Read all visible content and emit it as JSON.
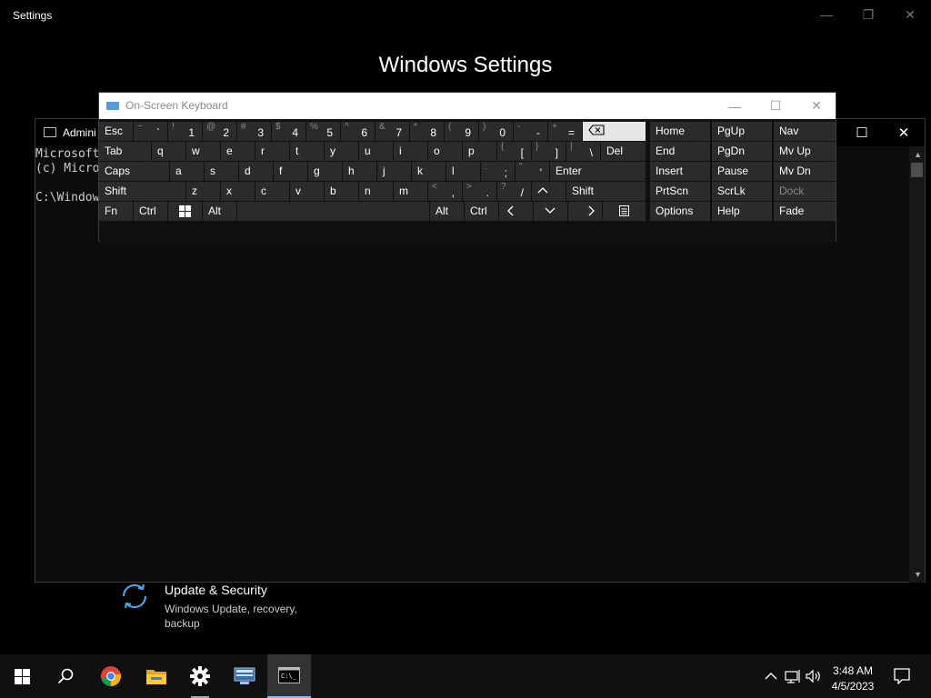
{
  "settings": {
    "title": "Settings",
    "heading": "Windows Settings",
    "tile": {
      "title": "Update & Security",
      "desc_line1": "Windows Update, recovery,",
      "desc_line2": "backup",
      "icon": "sync-icon"
    }
  },
  "cmd": {
    "title": "Admini",
    "lines": [
      "Microsoft",
      "(c) Micro",
      "",
      "C:\\Windows"
    ]
  },
  "osk": {
    "title": "On-Screen Keyboard",
    "rows": {
      "r1": [
        {
          "main": "Esc"
        },
        {
          "shift": "~",
          "main": "`"
        },
        {
          "shift": "!",
          "main": "1"
        },
        {
          "shift": "@",
          "main": "2"
        },
        {
          "shift": "#",
          "main": "3"
        },
        {
          "shift": "$",
          "main": "4"
        },
        {
          "shift": "%",
          "main": "5"
        },
        {
          "shift": "^",
          "main": "6"
        },
        {
          "shift": "&",
          "main": "7"
        },
        {
          "shift": "*",
          "main": "8"
        },
        {
          "shift": "(",
          "main": "9"
        },
        {
          "shift": ")",
          "main": "0"
        },
        {
          "shift": "-",
          "main": "-"
        },
        {
          "shift": "+",
          "main": "="
        },
        {
          "main": "",
          "icon": "backspace-icon"
        }
      ],
      "r2": [
        {
          "main": "Tab"
        },
        {
          "main": "q"
        },
        {
          "main": "w"
        },
        {
          "main": "e"
        },
        {
          "main": "r"
        },
        {
          "main": "t"
        },
        {
          "main": "y"
        },
        {
          "main": "u"
        },
        {
          "main": "i"
        },
        {
          "main": "o"
        },
        {
          "main": "p"
        },
        {
          "shift": "{",
          "main": "["
        },
        {
          "shift": "}",
          "main": "]"
        },
        {
          "shift": "|",
          "main": "\\"
        },
        {
          "main": "Del"
        }
      ],
      "r3": [
        {
          "main": "Caps"
        },
        {
          "main": "a"
        },
        {
          "main": "s"
        },
        {
          "main": "d"
        },
        {
          "main": "f"
        },
        {
          "main": "g"
        },
        {
          "main": "h"
        },
        {
          "main": "j"
        },
        {
          "main": "k"
        },
        {
          "main": "l"
        },
        {
          "shift": ":",
          "main": ";"
        },
        {
          "shift": "\"",
          "main": "'"
        },
        {
          "main": "Enter"
        }
      ],
      "r4": [
        {
          "main": "Shift"
        },
        {
          "main": "z"
        },
        {
          "main": "x"
        },
        {
          "main": "c"
        },
        {
          "main": "v"
        },
        {
          "main": "b"
        },
        {
          "main": "n"
        },
        {
          "main": "m"
        },
        {
          "shift": "<",
          "main": ","
        },
        {
          "shift": ">",
          "main": "."
        },
        {
          "shift": "?",
          "main": "/"
        },
        {
          "main": "",
          "icon": "arrow-up-icon"
        },
        {
          "main": "Shift"
        }
      ],
      "r5": [
        {
          "main": "Fn"
        },
        {
          "main": "Ctrl"
        },
        {
          "main": "",
          "icon": "windows-logo-icon"
        },
        {
          "main": "Alt"
        },
        {
          "main": ""
        },
        {
          "main": "Alt"
        },
        {
          "main": "Ctrl"
        },
        {
          "main": "",
          "icon": "arrow-left-icon"
        },
        {
          "main": "",
          "icon": "arrow-down-icon"
        },
        {
          "main": "",
          "icon": "arrow-right-icon"
        },
        {
          "main": "",
          "icon": "menu-key-icon"
        }
      ]
    },
    "nav": {
      "r1": [
        "Home",
        "PgUp",
        "Nav"
      ],
      "r2": [
        "End",
        "PgDn",
        "Mv Up"
      ],
      "r3": [
        "Insert",
        "Pause",
        "Mv Dn"
      ],
      "r4": [
        "PrtScn",
        "ScrLk",
        "Dock"
      ],
      "r5": [
        "Options",
        "Help",
        "Fade"
      ]
    }
  },
  "taskbar": {
    "apps": [
      "start-icon",
      "search-icon",
      "chrome-icon",
      "file-explorer-icon",
      "settings-gear-icon",
      "network-app-icon",
      "command-prompt-icon"
    ],
    "time": "3:48 AM",
    "date": "4/5/2023"
  }
}
